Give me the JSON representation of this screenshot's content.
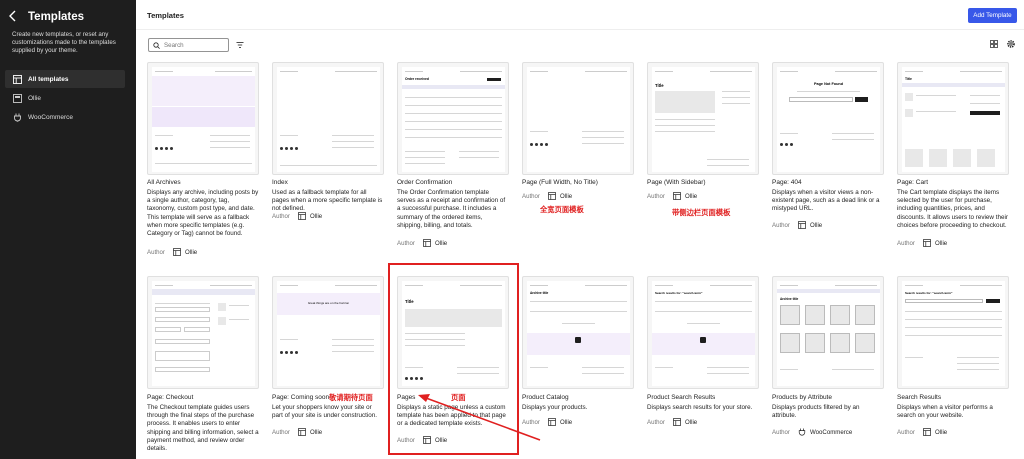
{
  "sidebar": {
    "title": "Templates",
    "description": "Create new templates, or reset any customizations made to the templates supplied by your theme.",
    "items": [
      {
        "label": "All templates",
        "icon": "layout-icon",
        "active": true
      },
      {
        "label": "Ollie",
        "icon": "theme-icon",
        "active": false
      },
      {
        "label": "WooCommerce",
        "icon": "plugin-icon",
        "active": false
      }
    ]
  },
  "header": {
    "title": "Templates",
    "add_label": "Add Template"
  },
  "search": {
    "placeholder": "Search"
  },
  "author_label": "Author",
  "templates": [
    {
      "name": "All Archives",
      "description": "Displays any archive, including posts by a single author, category, tag, taxonomy, custom post type, and date. This template will serve as a fallback when more specific templates (e.g. Category or Tag) cannot be found.",
      "author": "Ollie"
    },
    {
      "name": "Index",
      "description": "Used as a fallback template for all pages when a more specific template is not defined.",
      "author": "Ollie"
    },
    {
      "name": "Order Confirmation",
      "description": "The Order Confirmation template serves as a receipt and confirmation of a successful purchase. It includes a summary of the ordered items, shipping, billing, and totals.",
      "author": "Ollie"
    },
    {
      "name": "Page (Full Width, No Title)",
      "description": "",
      "author": "Ollie"
    },
    {
      "name": "Page (With Sidebar)",
      "description": "",
      "author": "Ollie"
    },
    {
      "name": "Page: 404",
      "description": "Displays when a visitor views a non-existent page, such as a dead link or a mistyped URL.",
      "author": "Ollie"
    },
    {
      "name": "Page: Cart",
      "description": "The Cart template displays the items selected by the user for purchase, including quantities, prices, and discounts. It allows users to review their choices before proceeding to checkout.",
      "author": "Ollie"
    },
    {
      "name": "Page: Checkout",
      "description": "The Checkout template guides users through the final steps of the purchase process. It enables users to enter shipping and billing information, select a payment method, and review order details.",
      "author": ""
    },
    {
      "name": "Page: Coming soon",
      "description": "Let your shoppers know your site or part of your site is under construction.",
      "author": "Ollie"
    },
    {
      "name": "Pages",
      "description": "Displays a static page unless a custom template has been applied to that page or a dedicated template exists.",
      "author": "Ollie"
    },
    {
      "name": "Product Catalog",
      "description": "Displays your products.",
      "author": "Ollie"
    },
    {
      "name": "Product Search Results",
      "description": "Displays search results for your store.",
      "author": "Ollie"
    },
    {
      "name": "Products by Attribute",
      "description": "Displays products filtered by an attribute.",
      "author": "WooCommerce"
    },
    {
      "name": "Search Results",
      "description": "Displays when a visitor performs a search on your website.",
      "author": "Ollie"
    }
  ],
  "thumb_text": {
    "order_received": "Order received",
    "not_found": "Page Not Found",
    "title": "Title",
    "coming_soon": "Great things are on the horizon",
    "archive_title": "Archive title",
    "search_results": "Search results for: \"search-term\""
  },
  "annotations": {
    "full_width": "全宽页面模板",
    "with_sidebar": "带侧边栏页面模板",
    "coming_soon": "敬请期待页面",
    "pages": "页面"
  },
  "colors": {
    "accent": "#3858e9",
    "annotation": "#e02020",
    "sidebar": "#1e1e1e"
  }
}
